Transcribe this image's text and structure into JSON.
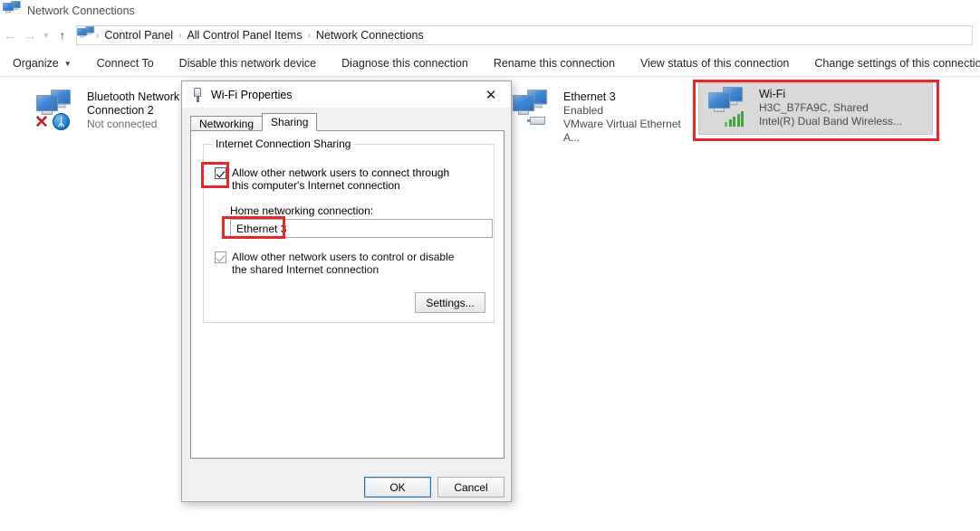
{
  "window": {
    "title": "Network Connections",
    "title_icon": "network-connections-icon"
  },
  "addressbar": {
    "back_icon": "back-arrow-icon",
    "forward_icon": "forward-arrow-icon",
    "history_icon": "chevron-down-icon",
    "up_icon": "up-arrow-icon",
    "path_icon": "network-connections-icon",
    "crumbs": [
      "Control Panel",
      "All Control Panel Items",
      "Network Connections"
    ],
    "separator": "›"
  },
  "commandbar": {
    "items": [
      {
        "label": "Organize",
        "has_caret": true
      },
      {
        "label": "Connect To",
        "has_caret": false
      },
      {
        "label": "Disable this network device",
        "has_caret": false
      },
      {
        "label": "Diagnose this connection",
        "has_caret": false
      },
      {
        "label": "Rename this connection",
        "has_caret": false
      },
      {
        "label": "View status of this connection",
        "has_caret": false
      },
      {
        "label": "Change settings of this connection",
        "has_caret": false
      }
    ],
    "caret_glyph": "▼"
  },
  "connections": [
    {
      "name": "Bluetooth Network Connection 2",
      "status": "Not connected",
      "device": "",
      "icon": "monitors-icon",
      "badge": "bluetooth-icon",
      "badge_glyph": "ᛦ",
      "error_glyph": "✕",
      "selected": false
    },
    {
      "name": "Ethernet 3",
      "status": "Enabled",
      "device": "VMware Virtual Ethernet A...",
      "icon": "monitors-icon",
      "badge": "network-adapter-icon",
      "selected": false
    },
    {
      "name": "Wi-Fi",
      "status": "H3C_B7FA9C, Shared",
      "device": "Intel(R) Dual Band Wireless...",
      "icon": "monitors-icon",
      "badge": "wifi-signal-bars-icon",
      "selected": true
    }
  ],
  "dialog": {
    "title": "Wi-Fi Properties",
    "title_icon": "network-adapter-icon",
    "close_glyph": "✕",
    "tabs": [
      {
        "label": "Networking",
        "active": false
      },
      {
        "label": "Sharing",
        "active": true
      }
    ],
    "group_legend": "Internet Connection Sharing",
    "checkbox_allow_connect": {
      "label": "Allow other network users to connect through this computer's Internet connection",
      "checked": true
    },
    "home_networking_label": "Home networking connection:",
    "home_networking_value": "Ethernet 3",
    "checkbox_allow_control": {
      "label": "Allow other network users to control or disable the shared Internet connection",
      "checked": true
    },
    "settings_button": "Settings...",
    "ok_button": "OK",
    "cancel_button": "Cancel"
  },
  "annotations": {
    "color": "#e8262c",
    "targets": [
      "wifi-connection-tile",
      "allow-connect-checkbox",
      "home-networking-value"
    ]
  }
}
